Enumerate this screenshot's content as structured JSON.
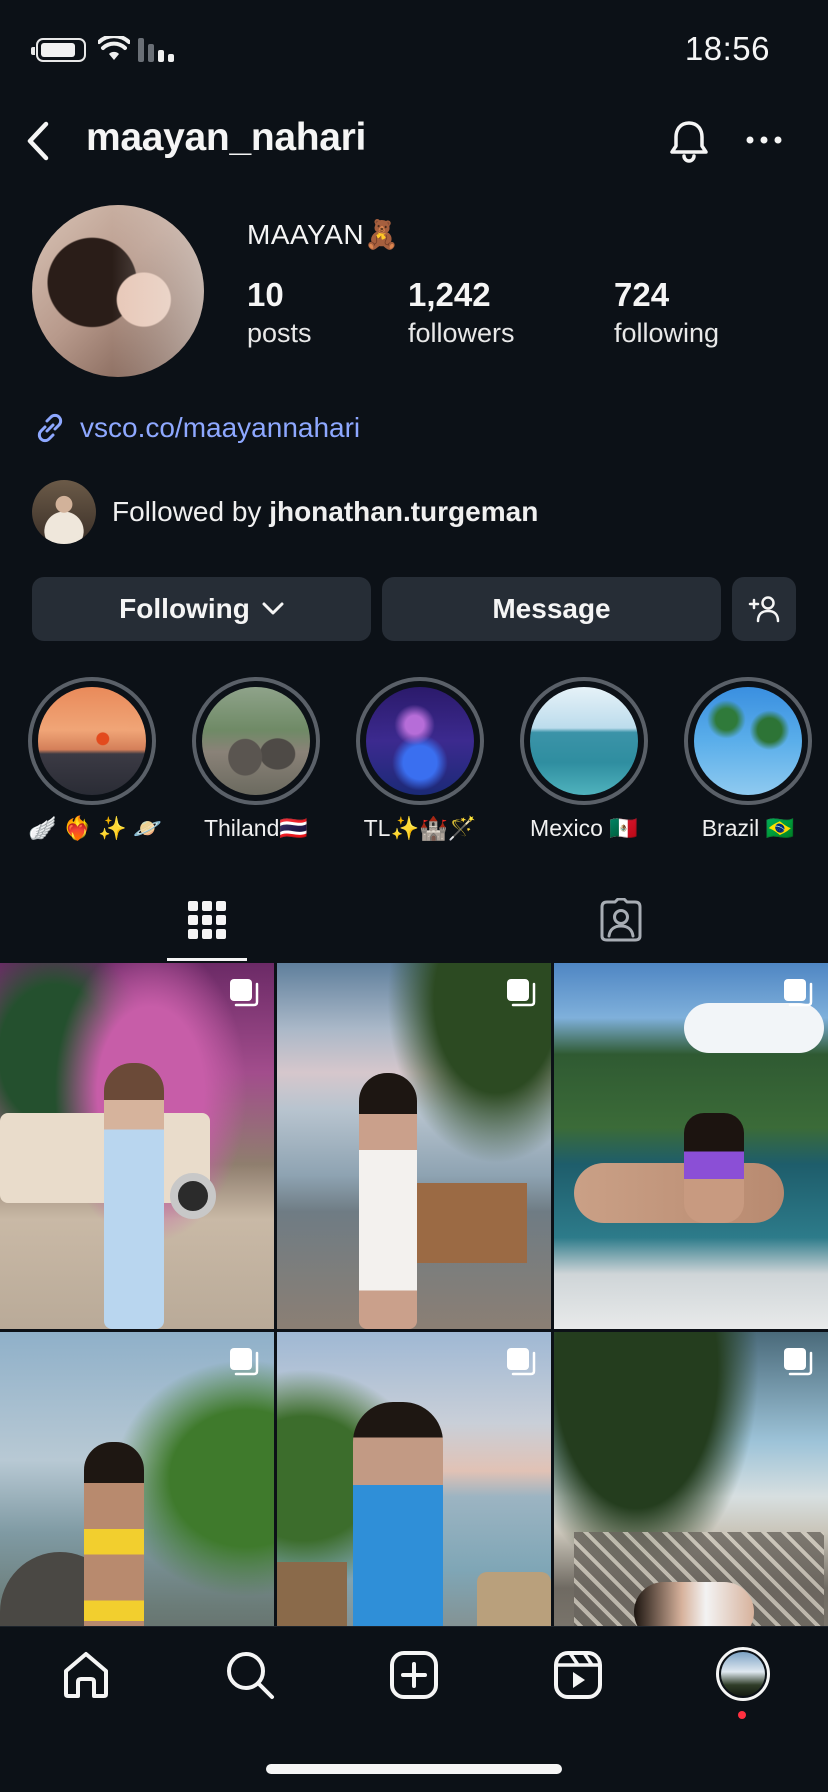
{
  "status_bar": {
    "time": "18:56"
  },
  "header": {
    "username": "maayan_nahari"
  },
  "profile": {
    "display_name": "MAAYAN🧸",
    "stats": [
      {
        "value": "10",
        "label": "posts"
      },
      {
        "value": "1,242",
        "label": "followers"
      },
      {
        "value": "724",
        "label": "following"
      }
    ],
    "link": "vsco.co/maayannahari",
    "followed_by_prefix": "Followed by ",
    "followed_by_user": "jhonathan.turgeman"
  },
  "buttons": {
    "following": "Following",
    "message": "Message"
  },
  "highlights": [
    {
      "label": "🪽 ❤️‍🔥 ✨ 🪐"
    },
    {
      "label": "Thiland🇹🇭"
    },
    {
      "label": "TL✨🏰🪄"
    },
    {
      "label": "Mexico 🇲🇽"
    },
    {
      "label": "Brazil 🇧🇷"
    }
  ],
  "tabs": [
    "posts-grid",
    "tagged"
  ],
  "colors": {
    "background": "#0c1117",
    "button": "#262d36",
    "link": "#8ea8ff",
    "notification_dot": "#ff3040"
  },
  "icons": [
    "battery-icon",
    "wifi-icon",
    "signal-icon",
    "back-icon",
    "bell-icon",
    "more-icon",
    "link-icon",
    "chevron-down-icon",
    "add-user-icon",
    "grid-icon",
    "tagged-icon",
    "multiple-posts-icon",
    "home-icon",
    "search-icon",
    "create-icon",
    "reels-icon"
  ]
}
